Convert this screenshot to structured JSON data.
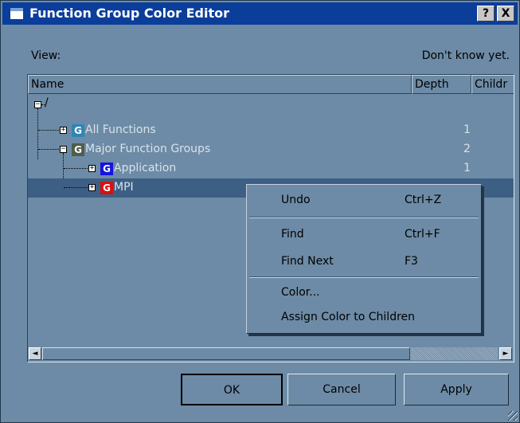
{
  "window": {
    "title": "Function Group Color Editor",
    "help_label": "?",
    "close_label": "X"
  },
  "view": {
    "label": "View:",
    "status": "Don't know yet."
  },
  "columns": {
    "name": "Name",
    "depth": "Depth",
    "children": "Childr"
  },
  "tree": {
    "root_label": "/",
    "glyph_letter": "G",
    "rows": [
      {
        "label": "All Functions",
        "depth": "1",
        "color": "#2f86b5",
        "expander": "+"
      },
      {
        "label": "Major Function Groups",
        "depth": "2",
        "color": "#4f5e4c",
        "expander": "−"
      },
      {
        "label": "Application",
        "depth": "1",
        "color": "#1414e0",
        "expander": "+"
      },
      {
        "label": "MPI",
        "depth": "",
        "color": "#d81010",
        "expander": "+"
      }
    ]
  },
  "context_menu": {
    "items": [
      {
        "label": "Undo",
        "shortcut": "Ctrl+Z"
      },
      {
        "label": "Find",
        "shortcut": "Ctrl+F"
      },
      {
        "label": "Find Next",
        "shortcut": "F3"
      },
      {
        "label": "Color...",
        "shortcut": ""
      },
      {
        "label": "Assign Color to Children",
        "shortcut": ""
      }
    ]
  },
  "buttons": {
    "ok": "OK",
    "cancel": "Cancel",
    "apply": "Apply"
  },
  "scrollbar": {
    "left_arrow": "◄",
    "right_arrow": "►"
  },
  "colors": {
    "background": "#6d8ba6",
    "titlebar": "#0b3d9a",
    "selection": "#3e5f84"
  }
}
